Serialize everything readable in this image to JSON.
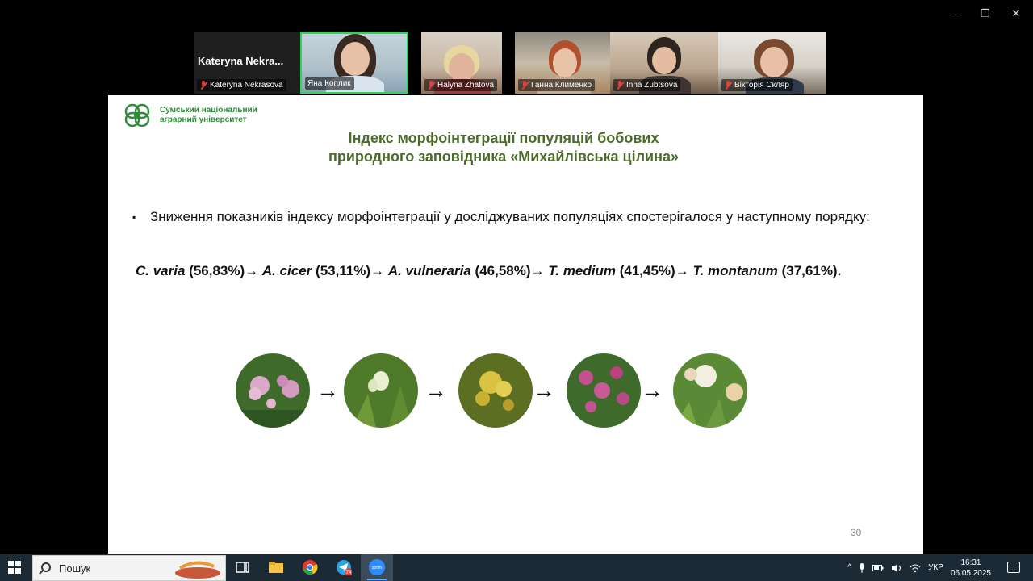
{
  "window": {
    "controls": {
      "minimize": "—",
      "restore": "❐",
      "close": "✕"
    }
  },
  "participants": [
    {
      "name": "Kateryna Nekrasova",
      "big_label": "Kateryna  Nekra...",
      "muted": true
    },
    {
      "name": "Яна Коплик",
      "muted": false,
      "active_speaker": true
    },
    {
      "name": "Halyna Zhatova",
      "muted": true
    },
    {
      "name": "Ганна Клименко",
      "muted": true
    },
    {
      "name": "Inna Zubtsova",
      "muted": true
    },
    {
      "name": "Вікторія Скляр",
      "muted": true
    }
  ],
  "slide": {
    "logo_line1": "Сумський національний",
    "logo_line2": "аграрний університет",
    "title_line1": "Індекс морфоінтеграції популяцій бобових",
    "title_line2": "природного заповідника «Михайлівська цілина»",
    "bullet_symbol": "▪",
    "bullet_text": "Зниження показників індексу морфоінтеграції у досліджуваних популяціях спостерігалося у наступному порядку:",
    "sequence": [
      {
        "species": "C. varia",
        "value": " (56,83%)"
      },
      {
        "species": "A. cicer",
        "value": " (53,11%)"
      },
      {
        "species": "A. vulneraria",
        "value": " (46,58%)"
      },
      {
        "species": "T. medium",
        "value": " (41,45%)"
      },
      {
        "species": "T. montanum",
        "value": " (37,61%)."
      }
    ],
    "arrow": "→",
    "page_number": "30"
  },
  "taskbar": {
    "search_placeholder": "Пошук",
    "telegram_badge": "74",
    "zoom_label": "zoom",
    "language": "УКР",
    "time": "16:31",
    "date": "06.05.2025"
  },
  "colors": {
    "title_green": "#4b6b2a",
    "logo_green": "#2f8a3a",
    "active_border": "#2fd45a",
    "taskbar": "#1c2a36"
  }
}
